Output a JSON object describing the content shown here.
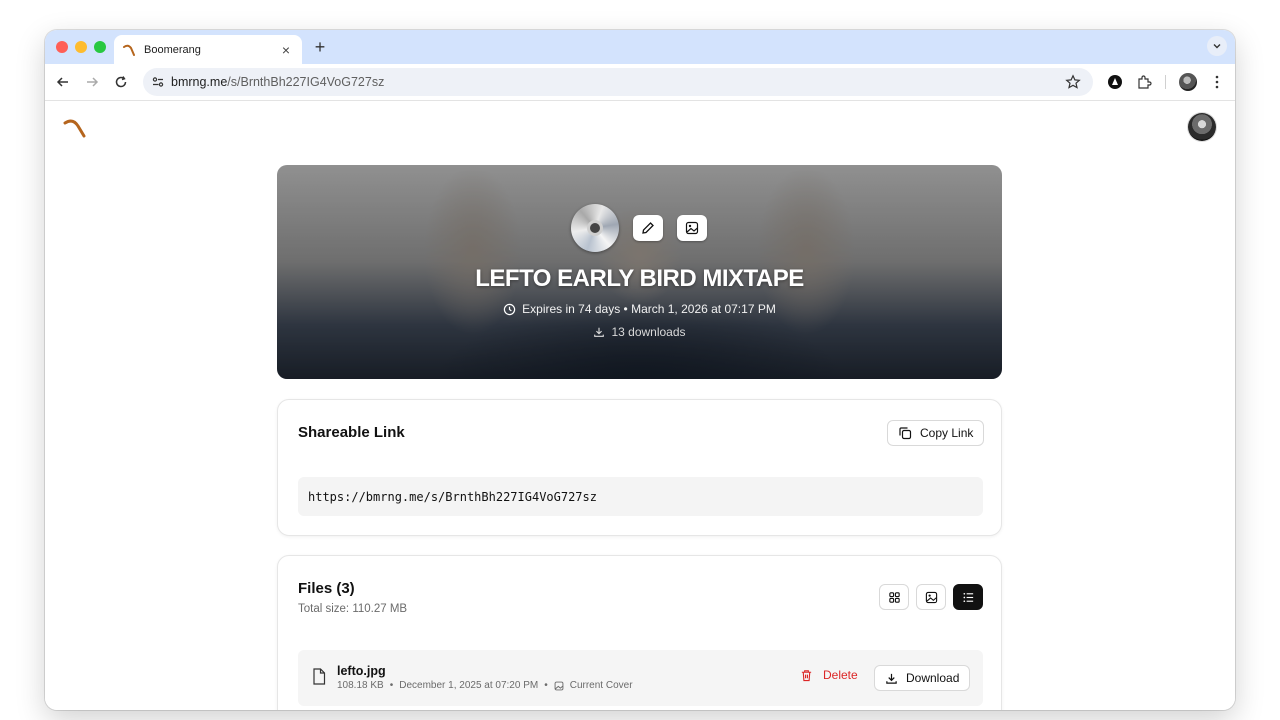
{
  "browser": {
    "tab_title": "Boomerang",
    "tab_close": "×",
    "new_tab": "+",
    "url_host": "bmrng.me",
    "url_path": "/s/BrnthBh227IG4VoG727sz"
  },
  "hero": {
    "title": "LEFTO EARLY BIRD MIXTAPE",
    "expires": "Expires in 74 days • March 1, 2026 at 07:17 PM",
    "downloads": "13 downloads"
  },
  "share": {
    "title": "Shareable Link",
    "copy_label": "Copy Link",
    "url": "https://bmrng.me/s/BrnthBh227IG4VoG727sz"
  },
  "files": {
    "title": "Files (3)",
    "total": "Total size: 110.27 MB",
    "items": [
      {
        "name": "lefto.jpg",
        "size": "108.18 KB",
        "date": "December 1, 2025 at 07:20 PM",
        "badge": "Current Cover",
        "delete_label": "Delete",
        "download_label": "Download"
      }
    ]
  },
  "meta_separator": "•",
  "colors": {
    "tabstrip": "#d3e3fd",
    "danger": "#dc2626",
    "accent_dark": "#111111",
    "logo": "#b5651d"
  },
  "icons": {
    "logo": "boomerang-icon",
    "expires": "clock-icon",
    "downloads": "download-icon",
    "copy": "copy-icon",
    "edit": "pencil-icon",
    "cover": "image-icon",
    "grid_view": "grid-icon",
    "gallery_view": "image-icon",
    "list_view": "list-icon",
    "file": "file-icon",
    "delete": "trash-icon"
  }
}
